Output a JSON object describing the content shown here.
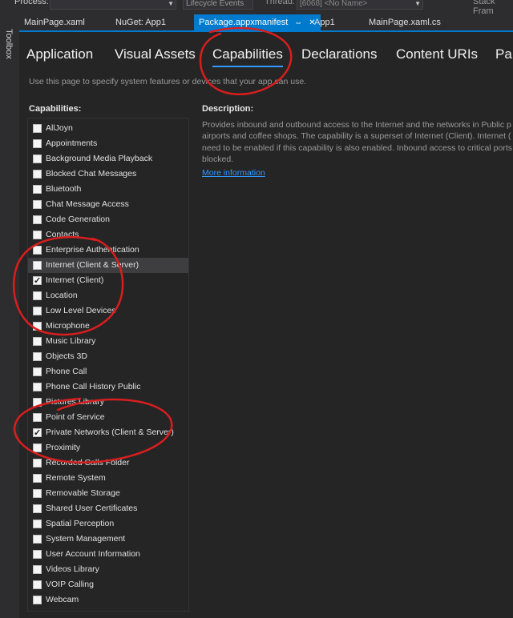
{
  "toolbar": {
    "process_label": "Process:",
    "lifecycle_label": "Lifecycle Events",
    "thread_label": "Thread:",
    "thread_value": "[6068] <No Name>",
    "stack_label": "Stack Fram"
  },
  "toolbox": {
    "label": "Toolbox"
  },
  "doc_tabs": [
    {
      "label": "MainPage.xaml"
    },
    {
      "label": "NuGet: App1"
    },
    {
      "label": "Package.appxmanifest",
      "pin": "⇔",
      "close": "✕"
    },
    {
      "label": "App1"
    },
    {
      "label": "MainPage.xaml.cs"
    }
  ],
  "page_tabs": [
    {
      "label": "Application"
    },
    {
      "label": "Visual Assets"
    },
    {
      "label": "Capabilities"
    },
    {
      "label": "Declarations"
    },
    {
      "label": "Content URIs"
    },
    {
      "label": "Pa"
    }
  ],
  "instruction": "Use this page to specify system features or devices that your app can use.",
  "capabilities_heading": "Capabilities:",
  "description_heading": "Description:",
  "capabilities": [
    {
      "label": "AllJoyn",
      "checked": false
    },
    {
      "label": "Appointments",
      "checked": false
    },
    {
      "label": "Background Media Playback",
      "checked": false
    },
    {
      "label": "Blocked Chat Messages",
      "checked": false
    },
    {
      "label": "Bluetooth",
      "checked": false
    },
    {
      "label": "Chat Message Access",
      "checked": false
    },
    {
      "label": "Code Generation",
      "checked": false
    },
    {
      "label": "Contacts",
      "checked": false
    },
    {
      "label": "Enterprise Authentication",
      "checked": false
    },
    {
      "label": "Internet (Client & Server)",
      "checked": false,
      "highlighted": true
    },
    {
      "label": "Internet (Client)",
      "checked": true
    },
    {
      "label": "Location",
      "checked": false
    },
    {
      "label": "Low Level Devices",
      "checked": false
    },
    {
      "label": "Microphone",
      "checked": false
    },
    {
      "label": "Music Library",
      "checked": false
    },
    {
      "label": "Objects 3D",
      "checked": false
    },
    {
      "label": "Phone Call",
      "checked": false
    },
    {
      "label": "Phone Call History Public",
      "checked": false
    },
    {
      "label": "Pictures Library",
      "checked": false
    },
    {
      "label": "Point of Service",
      "checked": false
    },
    {
      "label": "Private Networks (Client & Server)",
      "checked": true
    },
    {
      "label": "Proximity",
      "checked": false
    },
    {
      "label": "Recorded Calls Folder",
      "checked": false
    },
    {
      "label": "Remote System",
      "checked": false
    },
    {
      "label": "Removable Storage",
      "checked": false
    },
    {
      "label": "Shared User Certificates",
      "checked": false
    },
    {
      "label": "Spatial Perception",
      "checked": false
    },
    {
      "label": "System Management",
      "checked": false
    },
    {
      "label": "User Account Information",
      "checked": false
    },
    {
      "label": "Videos Library",
      "checked": false
    },
    {
      "label": "VOIP Calling",
      "checked": false
    },
    {
      "label": "Webcam",
      "checked": false
    }
  ],
  "description_lines": [
    "Provides inbound and outbound access to the Internet and the networks in Public p",
    "airports and coffee shops. The capability is a superset of Internet (Client). Internet (",
    "need to be enabled if this capability is also enabled. Inbound access to critical ports",
    "blocked."
  ],
  "more_info_link": "More information",
  "colors": {
    "accent": "#007acc",
    "annotation": "#d81e1e",
    "link": "#3399ff"
  }
}
